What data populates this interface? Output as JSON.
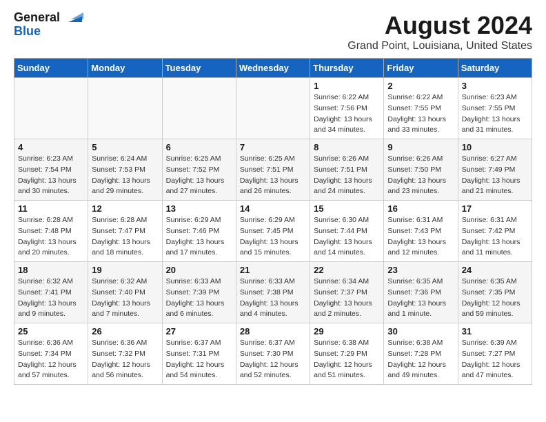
{
  "header": {
    "logo_line1": "General",
    "logo_line2": "Blue",
    "main_title": "August 2024",
    "subtitle": "Grand Point, Louisiana, United States"
  },
  "weekdays": [
    "Sunday",
    "Monday",
    "Tuesday",
    "Wednesday",
    "Thursday",
    "Friday",
    "Saturday"
  ],
  "weeks": [
    [
      {
        "day": "",
        "detail": ""
      },
      {
        "day": "",
        "detail": ""
      },
      {
        "day": "",
        "detail": ""
      },
      {
        "day": "",
        "detail": ""
      },
      {
        "day": "1",
        "detail": "Sunrise: 6:22 AM\nSunset: 7:56 PM\nDaylight: 13 hours\nand 34 minutes."
      },
      {
        "day": "2",
        "detail": "Sunrise: 6:22 AM\nSunset: 7:55 PM\nDaylight: 13 hours\nand 33 minutes."
      },
      {
        "day": "3",
        "detail": "Sunrise: 6:23 AM\nSunset: 7:55 PM\nDaylight: 13 hours\nand 31 minutes."
      }
    ],
    [
      {
        "day": "4",
        "detail": "Sunrise: 6:23 AM\nSunset: 7:54 PM\nDaylight: 13 hours\nand 30 minutes."
      },
      {
        "day": "5",
        "detail": "Sunrise: 6:24 AM\nSunset: 7:53 PM\nDaylight: 13 hours\nand 29 minutes."
      },
      {
        "day": "6",
        "detail": "Sunrise: 6:25 AM\nSunset: 7:52 PM\nDaylight: 13 hours\nand 27 minutes."
      },
      {
        "day": "7",
        "detail": "Sunrise: 6:25 AM\nSunset: 7:51 PM\nDaylight: 13 hours\nand 26 minutes."
      },
      {
        "day": "8",
        "detail": "Sunrise: 6:26 AM\nSunset: 7:51 PM\nDaylight: 13 hours\nand 24 minutes."
      },
      {
        "day": "9",
        "detail": "Sunrise: 6:26 AM\nSunset: 7:50 PM\nDaylight: 13 hours\nand 23 minutes."
      },
      {
        "day": "10",
        "detail": "Sunrise: 6:27 AM\nSunset: 7:49 PM\nDaylight: 13 hours\nand 21 minutes."
      }
    ],
    [
      {
        "day": "11",
        "detail": "Sunrise: 6:28 AM\nSunset: 7:48 PM\nDaylight: 13 hours\nand 20 minutes."
      },
      {
        "day": "12",
        "detail": "Sunrise: 6:28 AM\nSunset: 7:47 PM\nDaylight: 13 hours\nand 18 minutes."
      },
      {
        "day": "13",
        "detail": "Sunrise: 6:29 AM\nSunset: 7:46 PM\nDaylight: 13 hours\nand 17 minutes."
      },
      {
        "day": "14",
        "detail": "Sunrise: 6:29 AM\nSunset: 7:45 PM\nDaylight: 13 hours\nand 15 minutes."
      },
      {
        "day": "15",
        "detail": "Sunrise: 6:30 AM\nSunset: 7:44 PM\nDaylight: 13 hours\nand 14 minutes."
      },
      {
        "day": "16",
        "detail": "Sunrise: 6:31 AM\nSunset: 7:43 PM\nDaylight: 13 hours\nand 12 minutes."
      },
      {
        "day": "17",
        "detail": "Sunrise: 6:31 AM\nSunset: 7:42 PM\nDaylight: 13 hours\nand 11 minutes."
      }
    ],
    [
      {
        "day": "18",
        "detail": "Sunrise: 6:32 AM\nSunset: 7:41 PM\nDaylight: 13 hours\nand 9 minutes."
      },
      {
        "day": "19",
        "detail": "Sunrise: 6:32 AM\nSunset: 7:40 PM\nDaylight: 13 hours\nand 7 minutes."
      },
      {
        "day": "20",
        "detail": "Sunrise: 6:33 AM\nSunset: 7:39 PM\nDaylight: 13 hours\nand 6 minutes."
      },
      {
        "day": "21",
        "detail": "Sunrise: 6:33 AM\nSunset: 7:38 PM\nDaylight: 13 hours\nand 4 minutes."
      },
      {
        "day": "22",
        "detail": "Sunrise: 6:34 AM\nSunset: 7:37 PM\nDaylight: 13 hours\nand 2 minutes."
      },
      {
        "day": "23",
        "detail": "Sunrise: 6:35 AM\nSunset: 7:36 PM\nDaylight: 13 hours\nand 1 minute."
      },
      {
        "day": "24",
        "detail": "Sunrise: 6:35 AM\nSunset: 7:35 PM\nDaylight: 12 hours\nand 59 minutes."
      }
    ],
    [
      {
        "day": "25",
        "detail": "Sunrise: 6:36 AM\nSunset: 7:34 PM\nDaylight: 12 hours\nand 57 minutes."
      },
      {
        "day": "26",
        "detail": "Sunrise: 6:36 AM\nSunset: 7:32 PM\nDaylight: 12 hours\nand 56 minutes."
      },
      {
        "day": "27",
        "detail": "Sunrise: 6:37 AM\nSunset: 7:31 PM\nDaylight: 12 hours\nand 54 minutes."
      },
      {
        "day": "28",
        "detail": "Sunrise: 6:37 AM\nSunset: 7:30 PM\nDaylight: 12 hours\nand 52 minutes."
      },
      {
        "day": "29",
        "detail": "Sunrise: 6:38 AM\nSunset: 7:29 PM\nDaylight: 12 hours\nand 51 minutes."
      },
      {
        "day": "30",
        "detail": "Sunrise: 6:38 AM\nSunset: 7:28 PM\nDaylight: 12 hours\nand 49 minutes."
      },
      {
        "day": "31",
        "detail": "Sunrise: 6:39 AM\nSunset: 7:27 PM\nDaylight: 12 hours\nand 47 minutes."
      }
    ]
  ]
}
